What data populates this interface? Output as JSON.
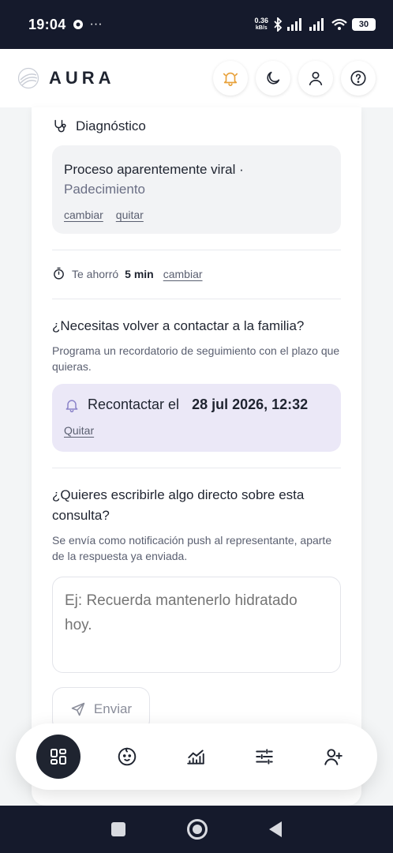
{
  "status_bar": {
    "time": "19:04",
    "net_speed_value": "0.36",
    "net_speed_unit": "kB/s",
    "battery": "30"
  },
  "header": {
    "brand": "AURA",
    "icons": [
      "bell-icon",
      "moon-icon",
      "user-icon",
      "help-icon"
    ]
  },
  "diagnosis": {
    "title": "Diagnóstico",
    "text": "Proceso aparentemente viral ·",
    "subtext": "Padecimiento",
    "change_link": "cambiar",
    "remove_link": "quitar"
  },
  "time_saved": {
    "prefix": "Te ahorró",
    "value": "5 min",
    "change_link": "cambiar"
  },
  "followup": {
    "question": "¿Necesitas volver a contactar a la familia?",
    "description": "Programa un recordatorio de seguimiento con el plazo que quieras.",
    "reminder_label": "Recontactar el",
    "reminder_date": "28 jul 2026, 12:32",
    "remove_link": "Quitar"
  },
  "direct_message": {
    "question": "¿Quieres escribirle algo directo sobre esta consulta?",
    "description": "Se envía como notificación push al representante, aparte de la respuesta ya enviada.",
    "placeholder": "Ej: Recuerda mantenerlo hidratado hoy.",
    "send_label": "Enviar"
  },
  "bottom_nav": {
    "items": [
      "dashboard-icon",
      "baby-face-icon",
      "chart-icon",
      "sliders-icon",
      "add-user-icon"
    ],
    "active": "dashboard-icon"
  },
  "colors": {
    "dark": "#151a2c",
    "reminder_bg": "#ebe8f7",
    "accent_purple": "#8b83c9"
  }
}
